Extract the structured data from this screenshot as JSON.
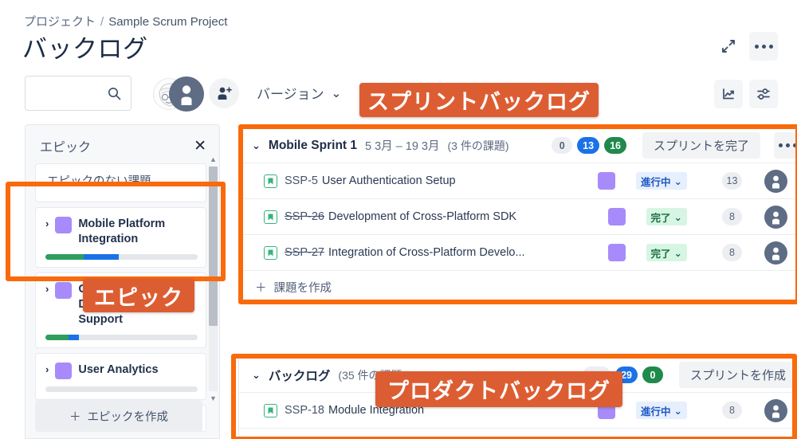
{
  "breadcrumb": {
    "project_label": "プロジェクト",
    "separator": "/",
    "project_name": "Sample Scrum Project"
  },
  "page": {
    "title": "バックログ"
  },
  "header_actions": [
    {
      "name": "expand-icon",
      "label": "拡大"
    },
    {
      "name": "more-icon",
      "label": "その他"
    },
    {
      "name": "chart-icon",
      "label": "レポート"
    },
    {
      "name": "settings-icon",
      "label": "ボード設定"
    }
  ],
  "toolbar": {
    "search_placeholder": "",
    "search_value": "",
    "search_icon": "search-icon",
    "avatar_icon": "avatar",
    "add_user_icon": "add-user-icon",
    "version_label": "バージョン",
    "version_chevron": "⌄"
  },
  "epic_panel": {
    "title": "エピック",
    "close_label": "✕",
    "create_label": "エピックを作成",
    "create_plus": "＋",
    "items": [
      {
        "name": "エピックのない課題",
        "has_chevron": false,
        "has_swatch": false,
        "progress": null
      },
      {
        "name": "Mobile Platform Integration",
        "has_chevron": true,
        "has_swatch": true,
        "chevron": "›",
        "progress": {
          "done": 25,
          "inprogress": 23
        }
      },
      {
        "name": "Cross-Platform Development Support",
        "has_chevron": true,
        "has_swatch": true,
        "chevron": "›",
        "progress": {
          "done": 15,
          "inprogress": 7
        }
      },
      {
        "name": "User Analytics",
        "has_chevron": true,
        "has_swatch": true,
        "chevron": "›",
        "progress": {
          "done": 0,
          "inprogress": 0
        }
      }
    ]
  },
  "sprint": {
    "chevron": "⌄",
    "title": "Mobile Sprint 1",
    "dates": "5 3月 – 19 3月",
    "issue_count": "(3 件の課題)",
    "badges": [
      {
        "value": "0",
        "color": "grey"
      },
      {
        "value": "13",
        "color": "blue"
      },
      {
        "value": "16",
        "color": "green"
      }
    ],
    "action_label": "スプリントを完了",
    "more_label": "•••",
    "create_issue_label": "課題を作成",
    "create_issue_plus": "＋",
    "issues": [
      {
        "type_icon": "story-icon",
        "key": "SSP-5",
        "key_struck": false,
        "summary": "User Authentication Setup",
        "epic_color": "#a78bfa",
        "status": "進行中",
        "status_kind": "inprogress",
        "status_chevron": "⌄",
        "points": "13",
        "assignee_icon": "avatar"
      },
      {
        "type_icon": "story-icon",
        "key": "SSP-26",
        "key_struck": true,
        "summary": "Development of Cross-Platform SDK",
        "epic_color": "#a78bfa",
        "status": "完了",
        "status_kind": "done",
        "status_chevron": "⌄",
        "points": "8",
        "assignee_icon": "avatar"
      },
      {
        "type_icon": "story-icon",
        "key": "SSP-27",
        "key_struck": true,
        "summary": "Integration of Cross-Platform Develo...",
        "epic_color": "#a78bfa",
        "status": "完了",
        "status_kind": "done",
        "status_chevron": "⌄",
        "points": "8",
        "assignee_icon": "avatar"
      }
    ]
  },
  "backlog": {
    "chevron": "⌄",
    "title": "バックログ",
    "issue_count": "(35 件の課題)",
    "badges": [
      {
        "value": "250",
        "color": "grey"
      },
      {
        "value": "29",
        "color": "blue"
      },
      {
        "value": "0",
        "color": "green"
      }
    ],
    "action_label": "スプリントを作成",
    "issues": [
      {
        "type_icon": "story-icon",
        "key": "SSP-18",
        "key_struck": false,
        "summary": "Module Integration",
        "epic_color": "#a78bfa",
        "status": "進行中",
        "status_kind": "inprogress",
        "status_chevron": "⌄",
        "points": "8",
        "assignee_icon": "avatar"
      }
    ]
  },
  "annotations": {
    "accent_color": "#f96a0c",
    "label_color": "#dd5d33",
    "labels": [
      {
        "key": "sprint",
        "text": "スプリントバックログ"
      },
      {
        "key": "epic",
        "text": "エピック"
      },
      {
        "key": "backlog",
        "text": "プロダクトバックログ"
      }
    ]
  }
}
